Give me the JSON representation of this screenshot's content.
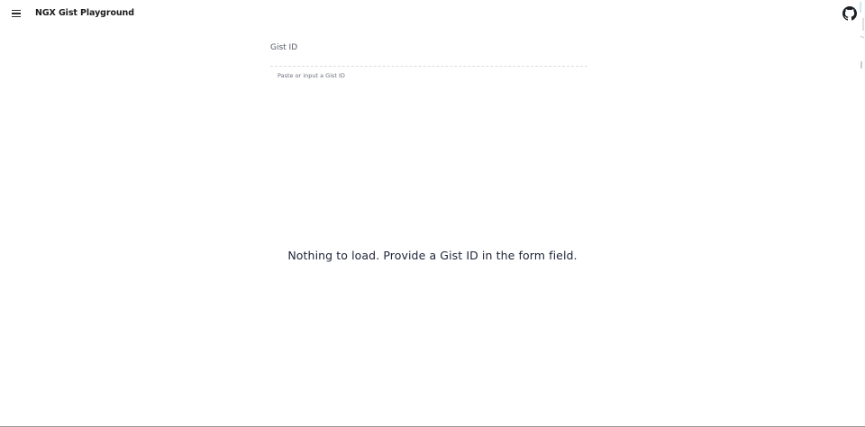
{
  "header": {
    "menu_icon": "menu-icon",
    "title": "NGX Gist Playground",
    "github_icon": "github-icon"
  },
  "form": {
    "label": "Gist ID",
    "value": "",
    "hint": "Paste or input a Gist ID"
  },
  "main": {
    "empty_message": "Nothing to load. Provide a Gist ID in the form field."
  }
}
